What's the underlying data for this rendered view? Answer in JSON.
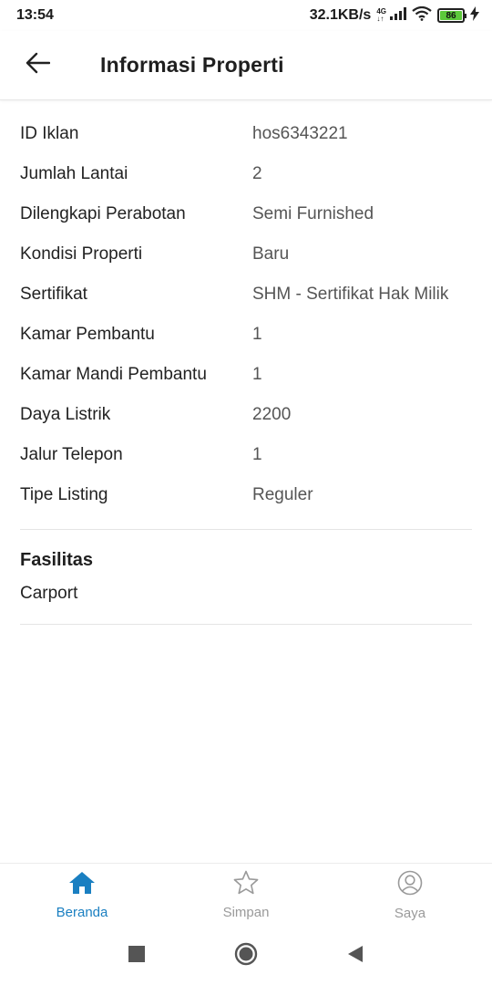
{
  "status_bar": {
    "time": "13:54",
    "speed": "32.1KB/s",
    "network_top": "4G",
    "network_bottom": "↓↑",
    "battery": "86"
  },
  "header": {
    "title": "Informasi Properti",
    "back_icon": "arrow-left-icon"
  },
  "details": [
    {
      "label": "ID Iklan",
      "value": "hos6343221"
    },
    {
      "label": "Jumlah Lantai",
      "value": "2"
    },
    {
      "label": "Dilengkapi Perabotan",
      "value": "Semi Furnished"
    },
    {
      "label": "Kondisi Properti",
      "value": "Baru"
    },
    {
      "label": "Sertifikat",
      "value": "SHM - Sertifikat Hak Milik"
    },
    {
      "label": "Kamar Pembantu",
      "value": "1"
    },
    {
      "label": "Kamar Mandi Pembantu",
      "value": "1"
    },
    {
      "label": "Daya Listrik",
      "value": "2200"
    },
    {
      "label": "Jalur Telepon",
      "value": "1"
    },
    {
      "label": "Tipe Listing",
      "value": "Reguler"
    }
  ],
  "facilities": {
    "title": "Fasilitas",
    "items": [
      "Carport"
    ]
  },
  "bottom_nav": {
    "items": [
      {
        "label": "Beranda",
        "icon": "home-icon",
        "active": true
      },
      {
        "label": "Simpan",
        "icon": "star-icon",
        "active": false
      },
      {
        "label": "Saya",
        "icon": "user-icon",
        "active": false
      }
    ]
  },
  "colors": {
    "accent": "#1a7fc1",
    "inactive": "#9a9a9a",
    "battery": "#5cc93b"
  }
}
